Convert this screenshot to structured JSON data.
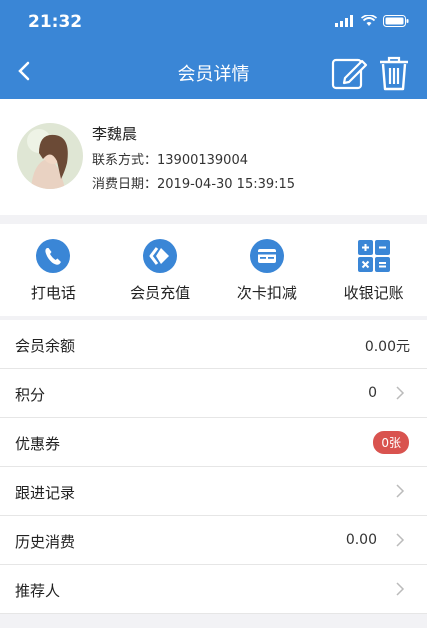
{
  "status": {
    "time": "21:32"
  },
  "nav": {
    "title": "会员详情",
    "back_icon": "back-chevron-icon",
    "edit_icon": "edit-icon",
    "delete_icon": "trash-icon"
  },
  "profile": {
    "name": "李魏晨",
    "phone_line": "联系方式：13900139004",
    "date_line": "消费日期：2019-04-30 15:39:15"
  },
  "actions": [
    {
      "label": "打电话",
      "icon": "phone-icon"
    },
    {
      "label": "会员充值",
      "icon": "recharge-icon"
    },
    {
      "label": "次卡扣减",
      "icon": "card-icon"
    },
    {
      "label": "收银记账",
      "icon": "calculator-icon"
    }
  ],
  "rows": [
    {
      "label": "会员余额",
      "value": "0.00元"
    },
    {
      "label": "积分",
      "value": "0"
    },
    {
      "label": "优惠券",
      "badge": "0张"
    },
    {
      "label": "跟进记录",
      "value": ""
    },
    {
      "label": "历史消费",
      "value": "0.00"
    },
    {
      "label": "推荐人",
      "value": ""
    }
  ],
  "colors": {
    "primary": "#3a86d6",
    "badge": "#d9534f"
  }
}
